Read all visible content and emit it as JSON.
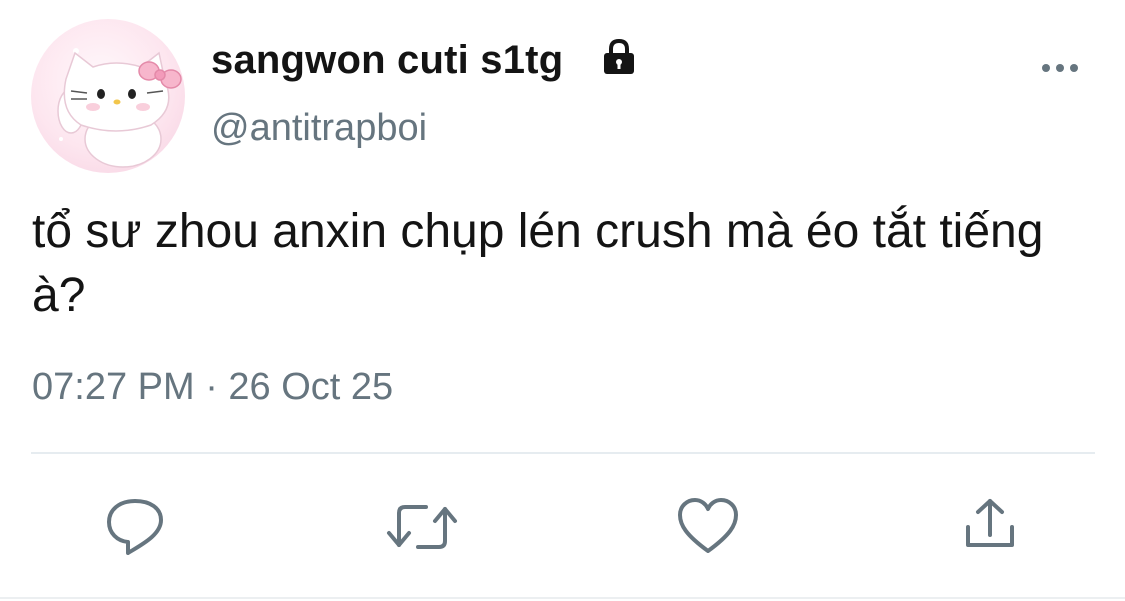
{
  "tweet": {
    "display_name": "sangwon cuti s1tg",
    "handle": "@antitrapboi",
    "text": "tổ sư zhou anxin chụp lén crush mà éo tắt tiếng à?",
    "timestamp": "07:27 PM · 26 Oct 25",
    "protected_icon": "lock-icon",
    "avatar": "hello-kitty-style cat avatar"
  },
  "actions": [
    {
      "name": "reply",
      "icon": "reply-icon"
    },
    {
      "name": "retweet",
      "icon": "retweet-icon"
    },
    {
      "name": "like",
      "icon": "heart-icon"
    },
    {
      "name": "share",
      "icon": "share-icon"
    }
  ],
  "colors": {
    "text": "#141414",
    "secondary": "#66757f",
    "divider": "#e6ecf0",
    "avatar_bg": "#fde6ef",
    "bow": "#f7b6cc"
  }
}
